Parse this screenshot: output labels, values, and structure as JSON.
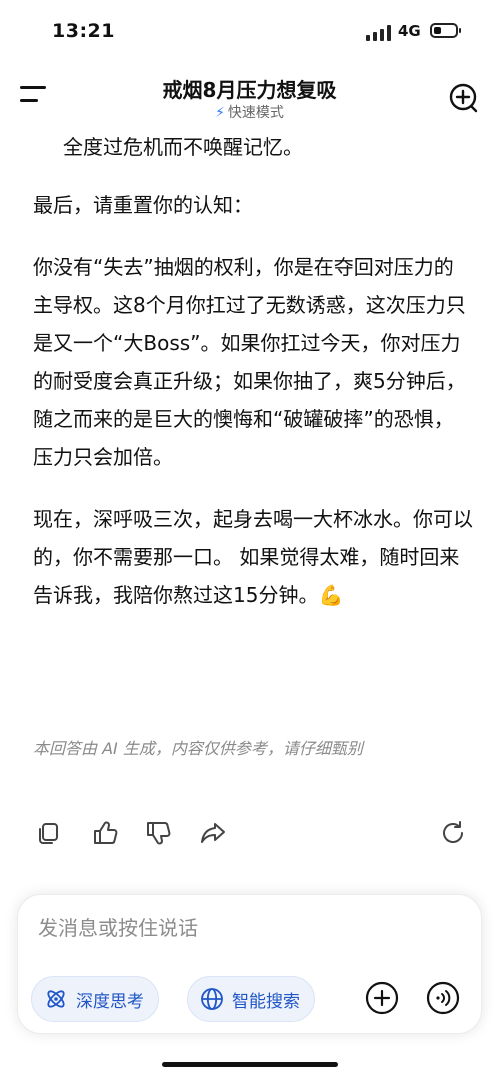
{
  "status": {
    "time": "13:21",
    "network": "4G",
    "battery_level": 0.35
  },
  "header": {
    "title": "戒烟8月压力想复吸",
    "mode_label": "快速模式"
  },
  "message": {
    "paragraphs": [
      "全度过危机而不唤醒记忆。",
      "最后，请重置你的认知：",
      "你没有“失去”抽烟的权利，你是在夺回对压力的主导权。这8个月你扛过了无数诱惑，这次压力只是又一个“大Boss”。如果你扛过今天，你对压力的耐受度会真正升级；如果你抽了，爽5分钟后，随之而来的是巨大的懊悔和“破罐破摔”的恐惧，压力只会加倍。",
      "现在，深呼吸三次，起身去喝一大杯冰水。你可以的，你不需要那一口。 如果觉得太难，随时回来告诉我，我陪你熬过这15分钟。💪"
    ],
    "disclaimer": "本回答由 AI 生成，内容仅供参考，请仔细甄别"
  },
  "actions": [
    "copy-icon",
    "thumbs-up-icon",
    "thumbs-down-icon",
    "share-icon",
    "regenerate-icon"
  ],
  "composer": {
    "placeholder": "发消息或按住说话",
    "deep_think_label": "深度思考",
    "smart_search_label": "智能搜索"
  },
  "colors": {
    "accent": "#2056c7",
    "chip_bg": "#eef2fb",
    "bolt": "#2f7df6"
  }
}
